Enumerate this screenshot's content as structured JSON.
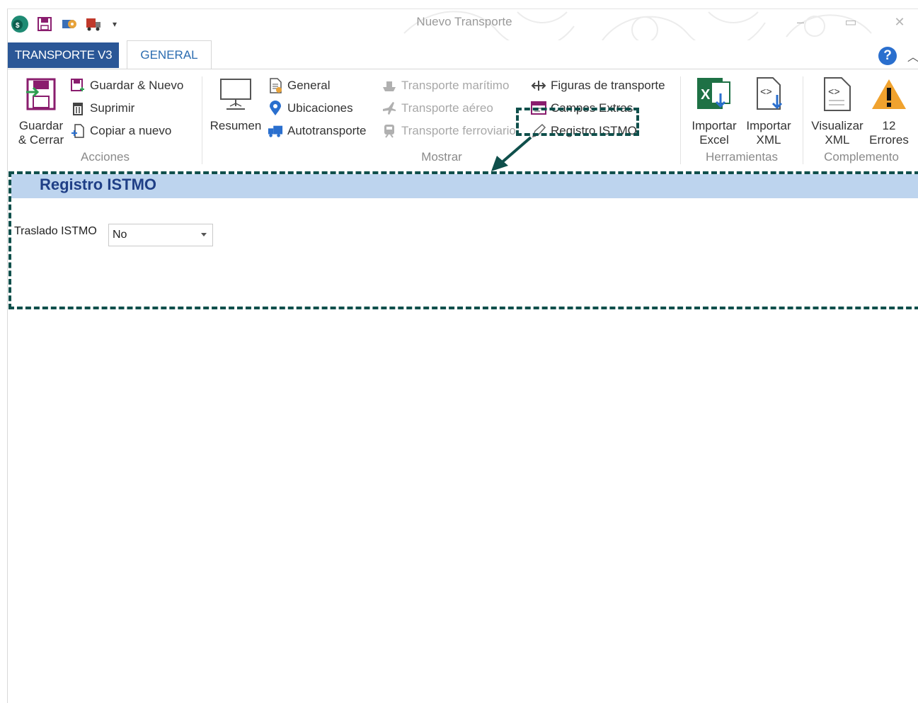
{
  "window": {
    "title": "Nuevo Transporte",
    "min": "–",
    "max": "▭",
    "close": "✕"
  },
  "tabs": {
    "file": "TRANSPORTE V3",
    "general": "GENERAL"
  },
  "ribbon": {
    "acciones": {
      "label": "Acciones",
      "guardar_cerrar_1": "Guardar",
      "guardar_cerrar_2": "& Cerrar",
      "guardar_nuevo": "Guardar & Nuevo",
      "suprimir": "Suprimir",
      "copiar": "Copiar a nuevo"
    },
    "mostrar": {
      "label": "Mostrar",
      "resumen": "Resumen",
      "general": "General",
      "ubicaciones": "Ubicaciones",
      "autotransporte": "Autotransporte",
      "maritimo": "Transporte marítimo",
      "aereo": "Transporte aéreo",
      "ferroviario": "Transporte ferroviario",
      "figuras": "Figuras de transporte",
      "campos": "Campos Extras",
      "istmo": "Registro ISTMO"
    },
    "herramientas": {
      "label": "Herramientas",
      "importar_excel_1": "Importar",
      "importar_excel_2": "Excel",
      "importar_xml_1": "Importar",
      "importar_xml_2": "XML"
    },
    "complemento": {
      "label": "Complemento",
      "visualizar_1": "Visualizar",
      "visualizar_2": "XML",
      "errores_count": "12",
      "errores_label": "Errores"
    }
  },
  "panel": {
    "title": "Registro ISTMO",
    "traslado_label": "Traslado ISTMO",
    "traslado_value": "No"
  }
}
